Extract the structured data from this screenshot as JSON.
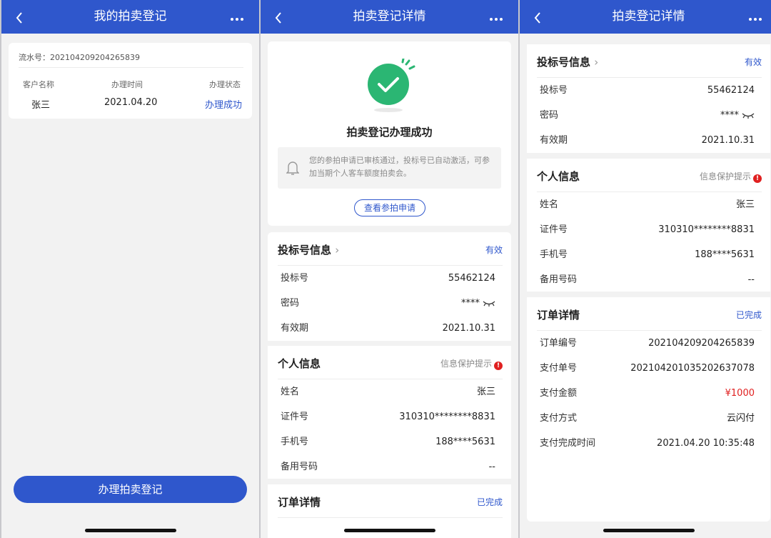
{
  "screen1": {
    "title": "我的拍卖登记",
    "serial_label": "流水号：",
    "serial_no": "202104209204265839",
    "columns": [
      "客户名称",
      "办理时间",
      "办理状态"
    ],
    "record": {
      "name": "张三",
      "date": "2021.04.20",
      "status": "办理成功"
    },
    "action_button": "办理拍卖登记"
  },
  "screen2": {
    "title": "拍卖登记详情",
    "success_title": "拍卖登记办理成功",
    "notice": "您的参拍申请已审核通过，投标号已自动激活，可参加当期个人客车额度拍卖会。",
    "view_button": "查看参拍申请",
    "bid": {
      "title": "投标号信息",
      "status": "有效",
      "rows": [
        {
          "k": "投标号",
          "v": "55462124"
        },
        {
          "k": "密码",
          "v": "****"
        },
        {
          "k": "有效期",
          "v": "2021.10.31"
        }
      ]
    },
    "personal": {
      "title": "个人信息",
      "hint": "信息保护提示",
      "rows": [
        {
          "k": "姓名",
          "v": "张三"
        },
        {
          "k": "证件号",
          "v": "310310********8831"
        },
        {
          "k": "手机号",
          "v": "188****5631"
        },
        {
          "k": "备用号码",
          "v": "--"
        }
      ]
    },
    "order": {
      "title": "订单详情",
      "status": "已完成"
    }
  },
  "screen3": {
    "title": "拍卖登记详情",
    "bid": {
      "title": "投标号信息",
      "status": "有效",
      "rows": [
        {
          "k": "投标号",
          "v": "55462124"
        },
        {
          "k": "密码",
          "v": "****"
        },
        {
          "k": "有效期",
          "v": "2021.10.31"
        }
      ]
    },
    "personal": {
      "title": "个人信息",
      "hint": "信息保护提示",
      "rows": [
        {
          "k": "姓名",
          "v": "张三"
        },
        {
          "k": "证件号",
          "v": "310310********8831"
        },
        {
          "k": "手机号",
          "v": "188****5631"
        },
        {
          "k": "备用号码",
          "v": "--"
        }
      ]
    },
    "order": {
      "title": "订单详情",
      "status": "已完成",
      "rows": [
        {
          "k": "订单编号",
          "v": "202104209204265839"
        },
        {
          "k": "支付单号",
          "v": "20210420103520263 7078"
        },
        {
          "k": "支付金额",
          "v": "¥1000"
        },
        {
          "k": "支付方式",
          "v": "云闪付"
        },
        {
          "k": "支付完成时间",
          "v": "2021.04.20 10:35:48"
        }
      ]
    }
  },
  "colors": {
    "brand": "#2f57cc",
    "success": "#2bb673",
    "price": "#e02020"
  },
  "icons": [
    "back-arrow-icon",
    "more-icon",
    "check-circle-icon",
    "bell-icon",
    "chevron-right-icon",
    "eye-closed-icon",
    "warning-icon"
  ]
}
